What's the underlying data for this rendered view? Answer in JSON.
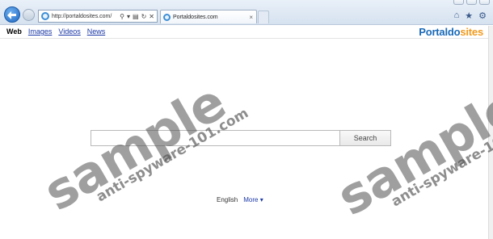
{
  "browser": {
    "address_url": "http://portaldosites.com/",
    "tab_title": "Portaldosites.com",
    "tab_close": "×",
    "address_search_icon": "⚲",
    "address_dropdown_icon": "▾",
    "address_compat_icon": "▤",
    "address_refresh_icon": "↻",
    "address_stop_icon": "✕",
    "home_icon": "⌂",
    "favorites_icon": "★",
    "tools_icon": "⚙"
  },
  "page": {
    "nav_tabs": [
      {
        "label": "Web"
      },
      {
        "label": "Images"
      },
      {
        "label": "Videos"
      },
      {
        "label": "News"
      }
    ],
    "logo": {
      "part1": "Portaldo",
      "part2": "sites"
    },
    "search": {
      "value": "",
      "button_label": "Search"
    },
    "footer": {
      "language": "English",
      "more_label": "More ▾"
    }
  },
  "watermark": {
    "big_text": "sample",
    "small_text": "anti-spyware-101.com"
  },
  "colors": {
    "link": "#1a37a5",
    "logo_blue": "#1a6ab8",
    "logo_orange": "#f19b1f"
  }
}
